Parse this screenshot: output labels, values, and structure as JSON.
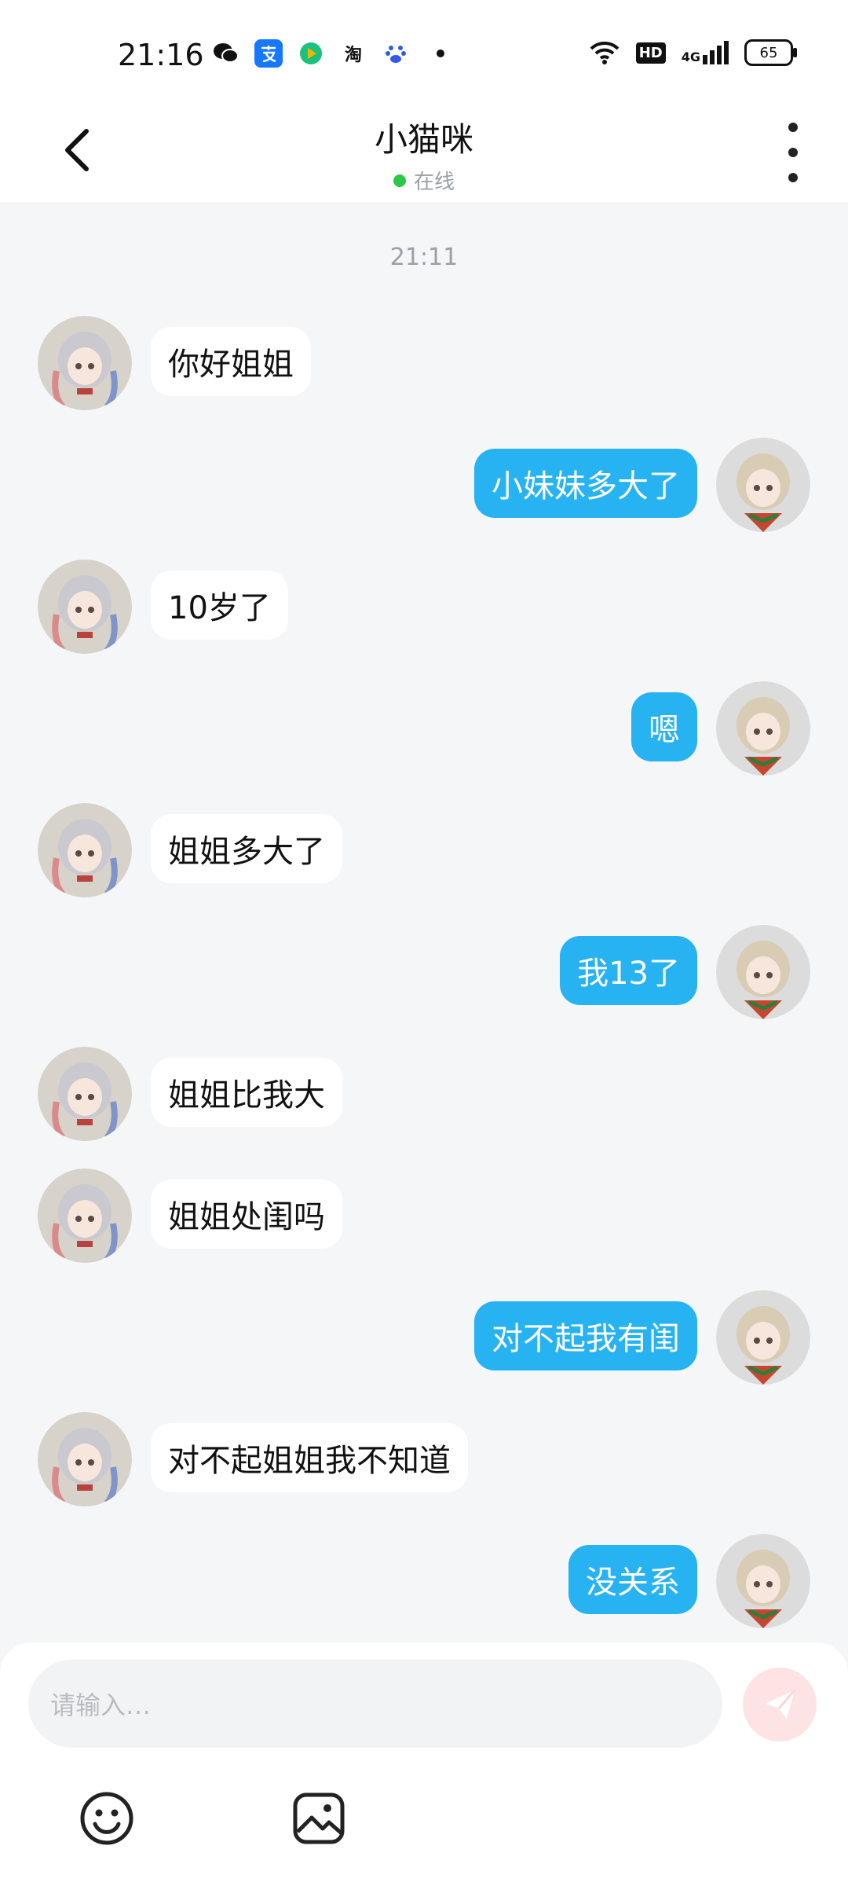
{
  "status_bar": {
    "time": "21:16",
    "app_icons": [
      "wechat-icon",
      "alipay-icon",
      "video-icon",
      "taobao-icon",
      "baidu-icon"
    ],
    "taobao_text": "淘",
    "battery": "65",
    "network": "4G",
    "hd_badge": "HD"
  },
  "header": {
    "title": "小猫咪",
    "status": "在线",
    "status_color": "#2bc94a"
  },
  "chat": {
    "timestamp": "21:11",
    "messages": [
      {
        "side": "left",
        "text": "你好姐姐"
      },
      {
        "side": "right",
        "text": "小妹妹多大了"
      },
      {
        "side": "left",
        "text": "10岁了"
      },
      {
        "side": "right",
        "text": "嗯"
      },
      {
        "side": "left",
        "text": "姐姐多大了"
      },
      {
        "side": "right",
        "text": "我13了"
      },
      {
        "side": "left",
        "text": "姐姐比我大"
      },
      {
        "side": "left",
        "text": "姐姐处闺吗"
      },
      {
        "side": "right",
        "text": "对不起我有闺"
      },
      {
        "side": "left",
        "text": "对不起姐姐我不知道"
      },
      {
        "side": "right",
        "text": "没关系"
      }
    ]
  },
  "composer": {
    "placeholder": "请输入…",
    "send_icon": "send-icon",
    "tools": [
      "emoji-icon",
      "image-icon"
    ]
  },
  "colors": {
    "accent": "#27b2f1",
    "background": "#f4f6f8"
  }
}
